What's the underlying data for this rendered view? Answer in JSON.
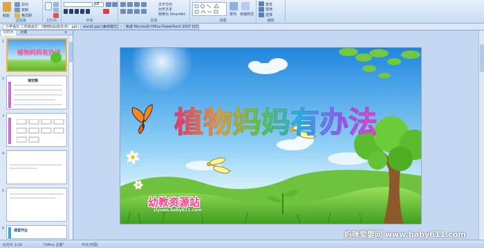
{
  "ribbon": {
    "groups": [
      {
        "label": "剪贴板"
      },
      {
        "label": "幻灯片"
      },
      {
        "label": "字体"
      },
      {
        "label": "段落"
      },
      {
        "label": "绘图"
      },
      {
        "label": "编辑"
      }
    ],
    "clipboard": {
      "paste_label": "粘贴",
      "cut_label": "剪切",
      "copy_label": "复制",
      "format_painter_label": "格式刷"
    },
    "slides": {
      "new_slide_label": "新建\n幻灯片",
      "layout_label": "版式",
      "reset_label": "重设",
      "delete_label": "删除"
    },
    "font": {
      "font_name": "",
      "font_size": "18"
    },
    "paragraph": {
      "text_direction_label": "文字方向",
      "align_text_label": "对齐文本",
      "smartart_label": "转换为 SmartArt"
    },
    "drawing": {
      "arrange_label": "排列",
      "quick_styles_label": "快速样式"
    },
    "editing": {
      "find_label": "查找",
      "replace_label": "替换",
      "select_label": "选择"
    }
  },
  "document_tabs": [
    {
      "label": "小学语文 二年级语文：《植物妈妈有办法》.ppt [兼容模式]",
      "active": true
    },
    {
      "label": "word1.ppt [兼容模式]",
      "active": false
    },
    {
      "label": "新建 Microsoft Office PowerPoint 2007 幻灯片.ppt",
      "active": false
    }
  ],
  "left_pane": {
    "tabs": [
      {
        "label": "幻灯片"
      },
      {
        "label": "大纲"
      }
    ],
    "slides": [
      {
        "number": "1",
        "caption": "植物妈妈有办法"
      },
      {
        "number": "2",
        "caption": "填空题"
      },
      {
        "number": "3",
        "caption": ""
      },
      {
        "number": "4",
        "caption": ""
      },
      {
        "number": "5",
        "caption": ""
      },
      {
        "number": "6",
        "caption": "课堂作业"
      }
    ]
  },
  "slide": {
    "title": "植物妈妈有办法",
    "logo_text": "幼教资源站",
    "logo_url": "ziyuan.baby611.com"
  },
  "watermark": "妈咪爱婴网 www.baby611.com",
  "status_bar": {
    "slide_indicator": "幻灯片 1/16",
    "theme": "\"Office 主题\"",
    "language": "中文(中国)"
  },
  "colors": {
    "accent_selected": "#f3b53b",
    "ribbon_bg": "#c9dcf3"
  }
}
